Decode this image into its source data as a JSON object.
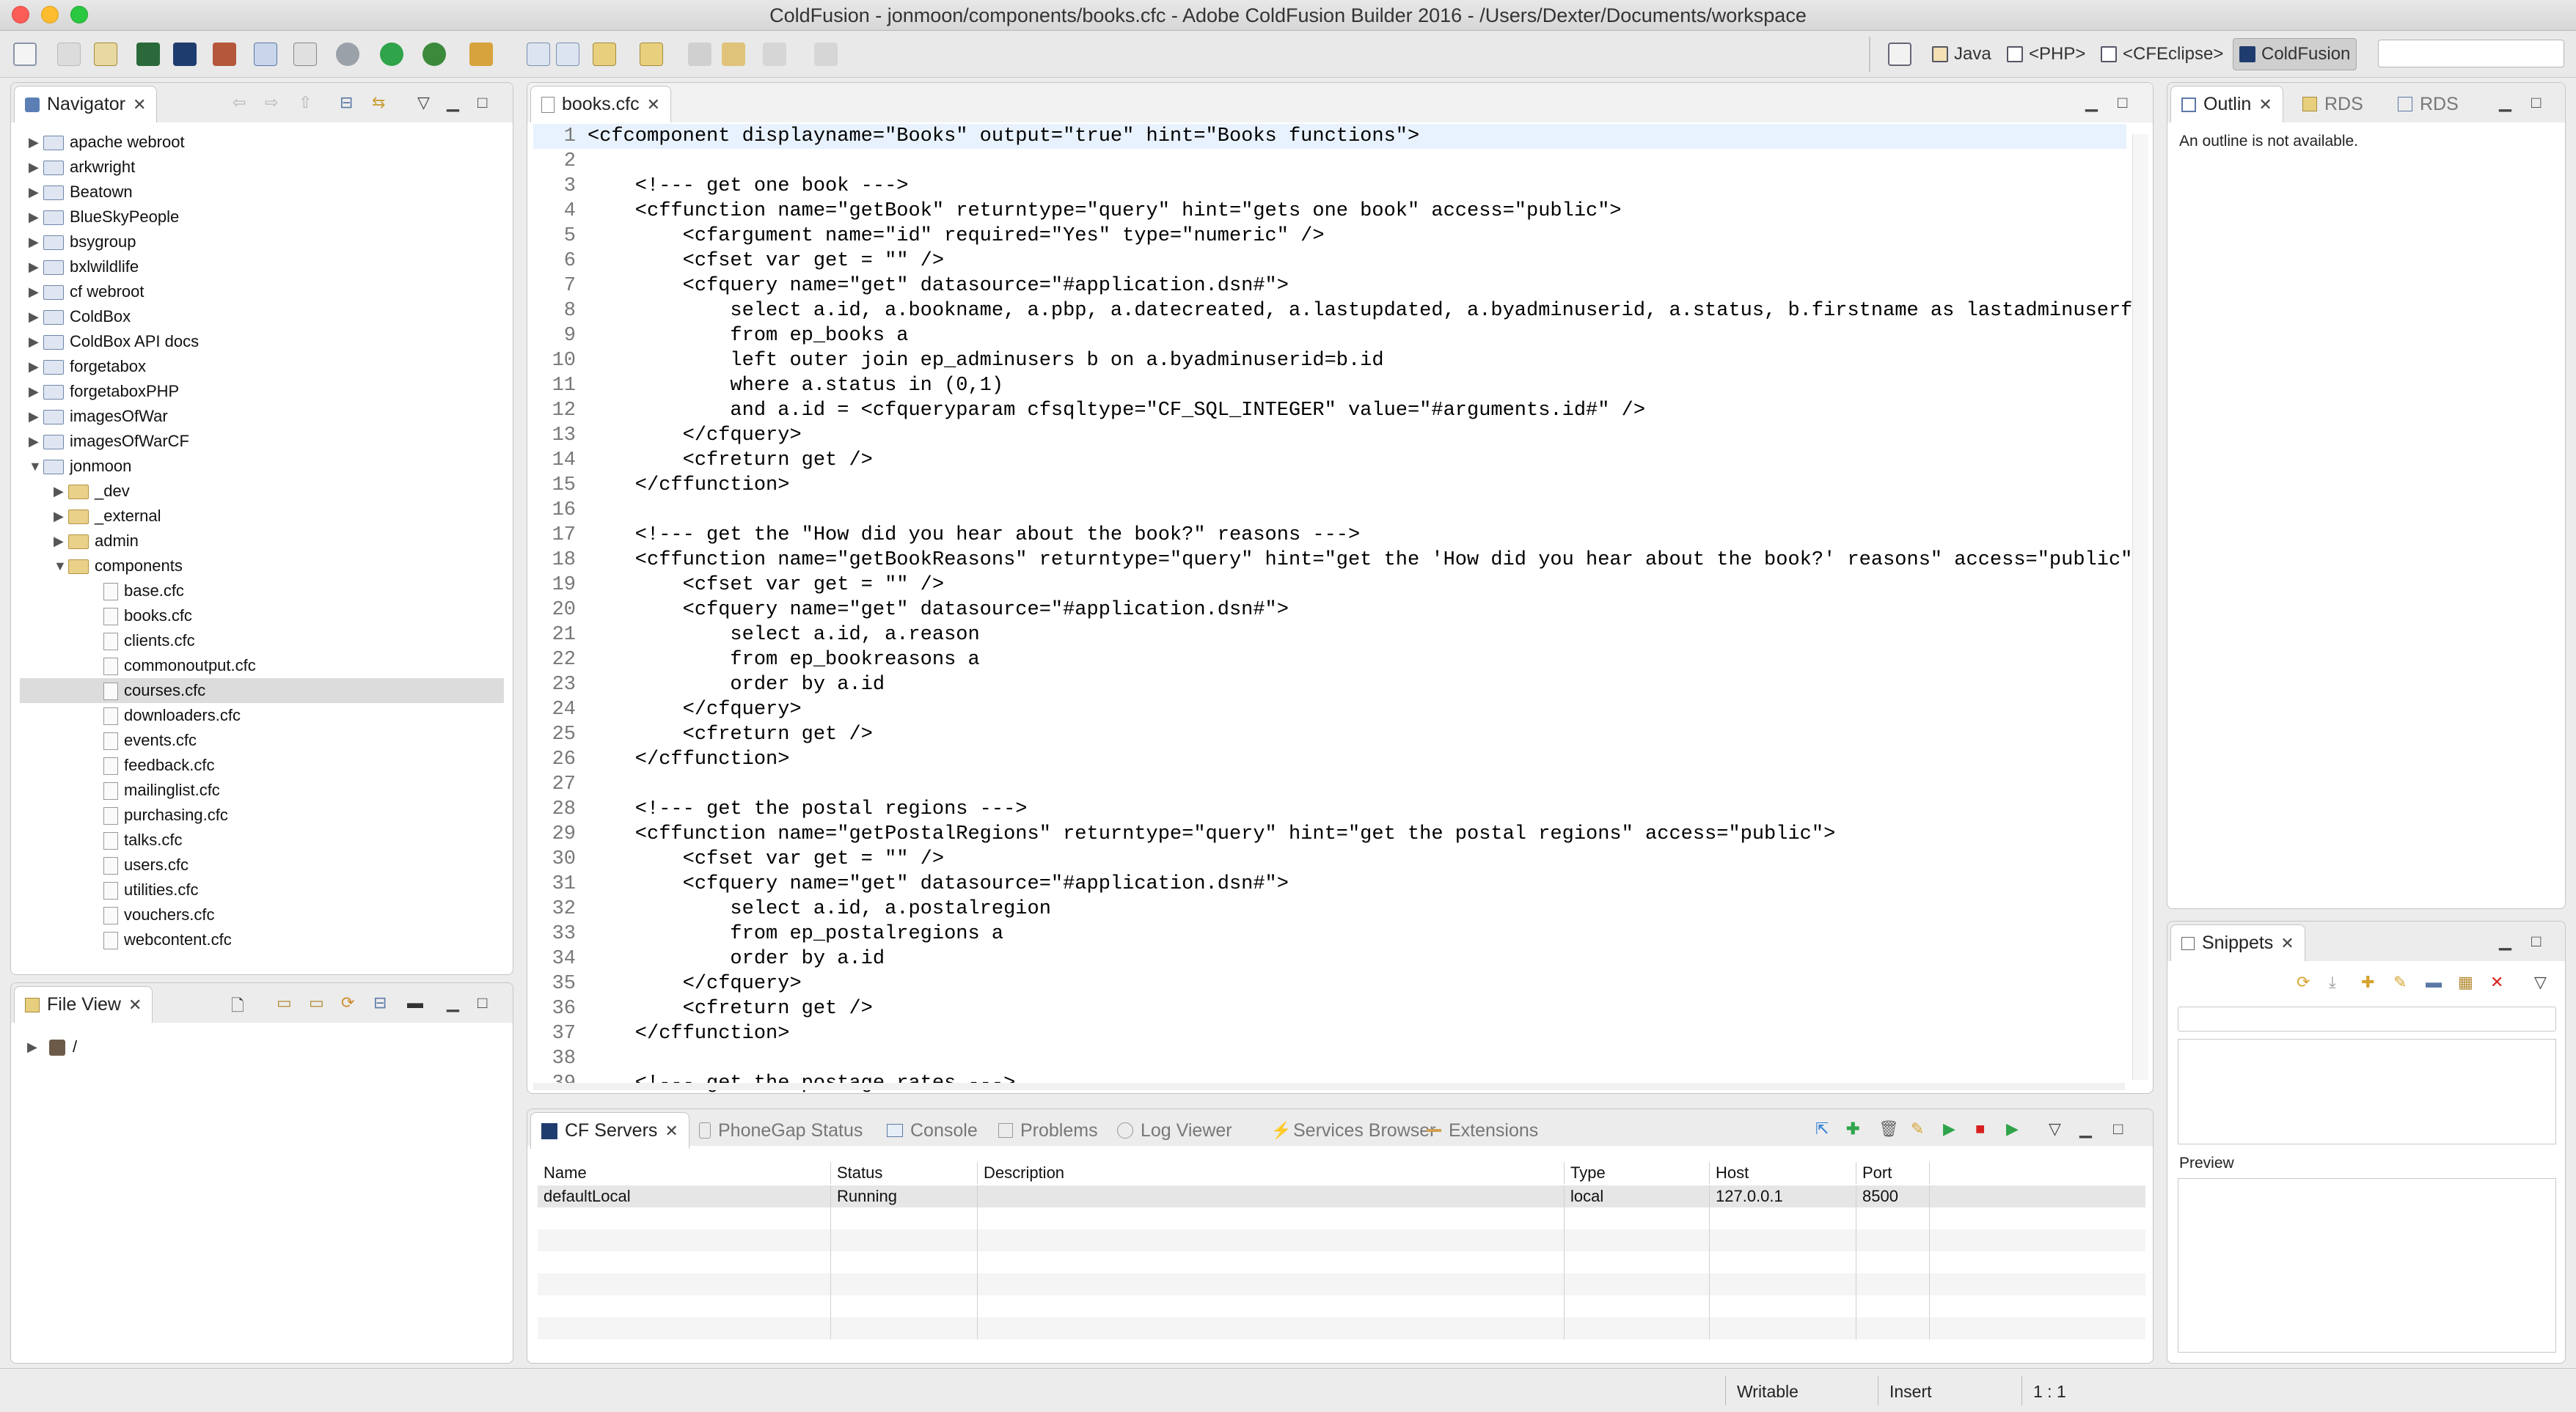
{
  "window": {
    "title": "ColdFusion - jonmoon/components/books.cfc - Adobe ColdFusion Builder 2016 - /Users/Dexter/Documents/workspace"
  },
  "perspectives": [
    {
      "label": "Java",
      "icon": "java-perspective-icon"
    },
    {
      "label": "<PHP>",
      "icon": "php-perspective-icon"
    },
    {
      "label": "<CFEclipse>",
      "icon": "cfeclipse-perspective-icon"
    },
    {
      "label": "ColdFusion",
      "icon": "coldfusion-perspective-icon",
      "active": true
    }
  ],
  "navigator": {
    "tab": "Navigator",
    "items": [
      {
        "label": "apache webroot",
        "kind": "project",
        "twisty": "▶",
        "depth": 0
      },
      {
        "label": "arkwright",
        "kind": "project",
        "twisty": "▶",
        "depth": 0
      },
      {
        "label": "Beatown",
        "kind": "project",
        "twisty": "▶",
        "depth": 0
      },
      {
        "label": "BlueSkyPeople",
        "kind": "project",
        "twisty": "▶",
        "depth": 0
      },
      {
        "label": "bsygroup",
        "kind": "project",
        "twisty": "▶",
        "depth": 0
      },
      {
        "label": "bxlwildlife",
        "kind": "project",
        "twisty": "▶",
        "depth": 0
      },
      {
        "label": "cf webroot",
        "kind": "project",
        "twisty": "▶",
        "depth": 0
      },
      {
        "label": "ColdBox",
        "kind": "project",
        "twisty": "▶",
        "depth": 0
      },
      {
        "label": "ColdBox API docs",
        "kind": "project",
        "twisty": "▶",
        "depth": 0
      },
      {
        "label": "forgetabox",
        "kind": "project",
        "twisty": "▶",
        "depth": 0
      },
      {
        "label": "forgetaboxPHP",
        "kind": "project",
        "twisty": "▶",
        "depth": 0
      },
      {
        "label": "imagesOfWar",
        "kind": "project",
        "twisty": "▶",
        "depth": 0
      },
      {
        "label": "imagesOfWarCF",
        "kind": "project",
        "twisty": "▶",
        "depth": 0
      },
      {
        "label": "jonmoon",
        "kind": "project",
        "twisty": "▼",
        "depth": 0
      },
      {
        "label": "_dev",
        "kind": "folder",
        "twisty": "▶",
        "depth": 1
      },
      {
        "label": "_external",
        "kind": "folder",
        "twisty": "▶",
        "depth": 1
      },
      {
        "label": "admin",
        "kind": "folder",
        "twisty": "▶",
        "depth": 1
      },
      {
        "label": "components",
        "kind": "folder",
        "twisty": "▼",
        "depth": 1
      },
      {
        "label": "base.cfc",
        "kind": "file",
        "twisty": "",
        "depth": 2
      },
      {
        "label": "books.cfc",
        "kind": "file",
        "twisty": "",
        "depth": 2
      },
      {
        "label": "clients.cfc",
        "kind": "file",
        "twisty": "",
        "depth": 2
      },
      {
        "label": "commonoutput.cfc",
        "kind": "file",
        "twisty": "",
        "depth": 2
      },
      {
        "label": "courses.cfc",
        "kind": "file",
        "twisty": "",
        "depth": 2,
        "selected": true
      },
      {
        "label": "downloaders.cfc",
        "kind": "file",
        "twisty": "",
        "depth": 2
      },
      {
        "label": "events.cfc",
        "kind": "file",
        "twisty": "",
        "depth": 2
      },
      {
        "label": "feedback.cfc",
        "kind": "file",
        "twisty": "",
        "depth": 2
      },
      {
        "label": "mailinglist.cfc",
        "kind": "file",
        "twisty": "",
        "depth": 2
      },
      {
        "label": "purchasing.cfc",
        "kind": "file",
        "twisty": "",
        "depth": 2
      },
      {
        "label": "talks.cfc",
        "kind": "file",
        "twisty": "",
        "depth": 2
      },
      {
        "label": "users.cfc",
        "kind": "file",
        "twisty": "",
        "depth": 2
      },
      {
        "label": "utilities.cfc",
        "kind": "file",
        "twisty": "",
        "depth": 2
      },
      {
        "label": "vouchers.cfc",
        "kind": "file",
        "twisty": "",
        "depth": 2
      },
      {
        "label": "webcontent.cfc",
        "kind": "file",
        "twisty": "",
        "depth": 2
      }
    ]
  },
  "fileview": {
    "tab": "File View",
    "root": "/"
  },
  "editor": {
    "tab": "books.cfc",
    "lines": [
      {
        "n": "1",
        "code": "<cfcomponent displayname=\"Books\" output=\"true\" hint=\"Books functions\">",
        "current": true
      },
      {
        "n": "2",
        "code": ""
      },
      {
        "n": "3",
        "code": "    <!--- get one book --->"
      },
      {
        "n": "4",
        "code": "    <cffunction name=\"getBook\" returntype=\"query\" hint=\"gets one book\" access=\"public\">"
      },
      {
        "n": "5",
        "code": "        <cfargument name=\"id\" required=\"Yes\" type=\"numeric\" />"
      },
      {
        "n": "6",
        "code": "        <cfset var get = \"\" />"
      },
      {
        "n": "7",
        "code": "        <cfquery name=\"get\" datasource=\"#application.dsn#\">"
      },
      {
        "n": "8",
        "code": "            select a.id, a.bookname, a.pbp, a.datecreated, a.lastupdated, a.byadminuserid, a.status, b.firstname as lastadminuserfi"
      },
      {
        "n": "9",
        "code": "            from ep_books a"
      },
      {
        "n": "10",
        "code": "            left outer join ep_adminusers b on a.byadminuserid=b.id"
      },
      {
        "n": "11",
        "code": "            where a.status in (0,1)"
      },
      {
        "n": "12",
        "code": "            and a.id = <cfqueryparam cfsqltype=\"CF_SQL_INTEGER\" value=\"#arguments.id#\" />"
      },
      {
        "n": "13",
        "code": "        </cfquery>"
      },
      {
        "n": "14",
        "code": "        <cfreturn get />"
      },
      {
        "n": "15",
        "code": "    </cffunction>"
      },
      {
        "n": "16",
        "code": ""
      },
      {
        "n": "17",
        "code": "    <!--- get the \"How did you hear about the book?\" reasons --->"
      },
      {
        "n": "18",
        "code": "    <cffunction name=\"getBookReasons\" returntype=\"query\" hint=\"get the 'How did you hear about the book?' reasons\" access=\"public\":"
      },
      {
        "n": "19",
        "code": "        <cfset var get = \"\" />"
      },
      {
        "n": "20",
        "code": "        <cfquery name=\"get\" datasource=\"#application.dsn#\">"
      },
      {
        "n": "21",
        "code": "            select a.id, a.reason"
      },
      {
        "n": "22",
        "code": "            from ep_bookreasons a"
      },
      {
        "n": "23",
        "code": "            order by a.id"
      },
      {
        "n": "24",
        "code": "        </cfquery>"
      },
      {
        "n": "25",
        "code": "        <cfreturn get />"
      },
      {
        "n": "26",
        "code": "    </cffunction>"
      },
      {
        "n": "27",
        "code": ""
      },
      {
        "n": "28",
        "code": "    <!--- get the postal regions --->"
      },
      {
        "n": "29",
        "code": "    <cffunction name=\"getPostalRegions\" returntype=\"query\" hint=\"get the postal regions\" access=\"public\">"
      },
      {
        "n": "30",
        "code": "        <cfset var get = \"\" />"
      },
      {
        "n": "31",
        "code": "        <cfquery name=\"get\" datasource=\"#application.dsn#\">"
      },
      {
        "n": "32",
        "code": "            select a.id, a.postalregion"
      },
      {
        "n": "33",
        "code": "            from ep_postalregions a"
      },
      {
        "n": "34",
        "code": "            order by a.id"
      },
      {
        "n": "35",
        "code": "        </cfquery>"
      },
      {
        "n": "36",
        "code": "        <cfreturn get />"
      },
      {
        "n": "37",
        "code": "    </cffunction>"
      },
      {
        "n": "38",
        "code": ""
      },
      {
        "n": "39",
        "code": "    <!--- get the postage rates --->"
      }
    ]
  },
  "outline": {
    "tabs": [
      "Outlin",
      "RDS",
      "RDS"
    ],
    "message": "An outline is not available."
  },
  "snippets": {
    "tab": "Snippets",
    "preview_label": "Preview"
  },
  "bottom": {
    "tabs": [
      "CF Servers",
      "PhoneGap Status",
      "Console",
      "Problems",
      "Log Viewer",
      "Services Browser",
      "Extensions"
    ],
    "columns": [
      "Name",
      "Status",
      "Description",
      "Type",
      "Host",
      "Port"
    ],
    "rows": [
      {
        "name": "defaultLocal",
        "status": "Running",
        "description": "",
        "type": "local",
        "host": "127.0.0.1",
        "port": "8500"
      }
    ]
  },
  "statusbar": {
    "writable": "Writable",
    "insert": "Insert",
    "position": "1 : 1"
  }
}
